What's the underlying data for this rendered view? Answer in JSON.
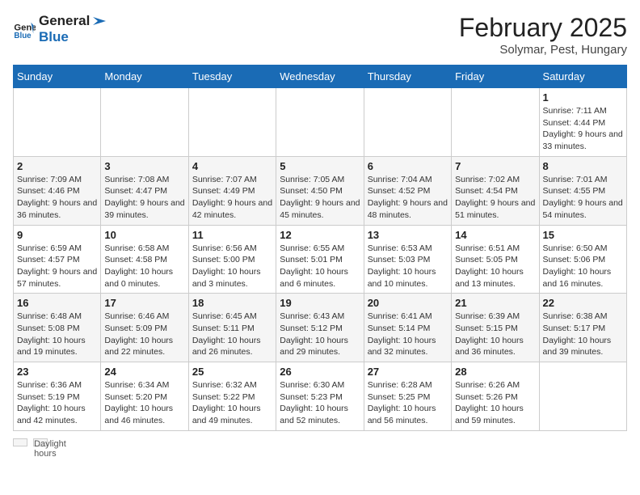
{
  "header": {
    "logo_line1": "General",
    "logo_line2": "Blue",
    "title": "February 2025",
    "subtitle": "Solymar, Pest, Hungary"
  },
  "days_of_week": [
    "Sunday",
    "Monday",
    "Tuesday",
    "Wednesday",
    "Thursday",
    "Friday",
    "Saturday"
  ],
  "weeks": [
    [
      {
        "day": "",
        "info": ""
      },
      {
        "day": "",
        "info": ""
      },
      {
        "day": "",
        "info": ""
      },
      {
        "day": "",
        "info": ""
      },
      {
        "day": "",
        "info": ""
      },
      {
        "day": "",
        "info": ""
      },
      {
        "day": "1",
        "info": "Sunrise: 7:11 AM\nSunset: 4:44 PM\nDaylight: 9 hours and 33 minutes."
      }
    ],
    [
      {
        "day": "2",
        "info": "Sunrise: 7:09 AM\nSunset: 4:46 PM\nDaylight: 9 hours and 36 minutes."
      },
      {
        "day": "3",
        "info": "Sunrise: 7:08 AM\nSunset: 4:47 PM\nDaylight: 9 hours and 39 minutes."
      },
      {
        "day": "4",
        "info": "Sunrise: 7:07 AM\nSunset: 4:49 PM\nDaylight: 9 hours and 42 minutes."
      },
      {
        "day": "5",
        "info": "Sunrise: 7:05 AM\nSunset: 4:50 PM\nDaylight: 9 hours and 45 minutes."
      },
      {
        "day": "6",
        "info": "Sunrise: 7:04 AM\nSunset: 4:52 PM\nDaylight: 9 hours and 48 minutes."
      },
      {
        "day": "7",
        "info": "Sunrise: 7:02 AM\nSunset: 4:54 PM\nDaylight: 9 hours and 51 minutes."
      },
      {
        "day": "8",
        "info": "Sunrise: 7:01 AM\nSunset: 4:55 PM\nDaylight: 9 hours and 54 minutes."
      }
    ],
    [
      {
        "day": "9",
        "info": "Sunrise: 6:59 AM\nSunset: 4:57 PM\nDaylight: 9 hours and 57 minutes."
      },
      {
        "day": "10",
        "info": "Sunrise: 6:58 AM\nSunset: 4:58 PM\nDaylight: 10 hours and 0 minutes."
      },
      {
        "day": "11",
        "info": "Sunrise: 6:56 AM\nSunset: 5:00 PM\nDaylight: 10 hours and 3 minutes."
      },
      {
        "day": "12",
        "info": "Sunrise: 6:55 AM\nSunset: 5:01 PM\nDaylight: 10 hours and 6 minutes."
      },
      {
        "day": "13",
        "info": "Sunrise: 6:53 AM\nSunset: 5:03 PM\nDaylight: 10 hours and 10 minutes."
      },
      {
        "day": "14",
        "info": "Sunrise: 6:51 AM\nSunset: 5:05 PM\nDaylight: 10 hours and 13 minutes."
      },
      {
        "day": "15",
        "info": "Sunrise: 6:50 AM\nSunset: 5:06 PM\nDaylight: 10 hours and 16 minutes."
      }
    ],
    [
      {
        "day": "16",
        "info": "Sunrise: 6:48 AM\nSunset: 5:08 PM\nDaylight: 10 hours and 19 minutes."
      },
      {
        "day": "17",
        "info": "Sunrise: 6:46 AM\nSunset: 5:09 PM\nDaylight: 10 hours and 22 minutes."
      },
      {
        "day": "18",
        "info": "Sunrise: 6:45 AM\nSunset: 5:11 PM\nDaylight: 10 hours and 26 minutes."
      },
      {
        "day": "19",
        "info": "Sunrise: 6:43 AM\nSunset: 5:12 PM\nDaylight: 10 hours and 29 minutes."
      },
      {
        "day": "20",
        "info": "Sunrise: 6:41 AM\nSunset: 5:14 PM\nDaylight: 10 hours and 32 minutes."
      },
      {
        "day": "21",
        "info": "Sunrise: 6:39 AM\nSunset: 5:15 PM\nDaylight: 10 hours and 36 minutes."
      },
      {
        "day": "22",
        "info": "Sunrise: 6:38 AM\nSunset: 5:17 PM\nDaylight: 10 hours and 39 minutes."
      }
    ],
    [
      {
        "day": "23",
        "info": "Sunrise: 6:36 AM\nSunset: 5:19 PM\nDaylight: 10 hours and 42 minutes."
      },
      {
        "day": "24",
        "info": "Sunrise: 6:34 AM\nSunset: 5:20 PM\nDaylight: 10 hours and 46 minutes."
      },
      {
        "day": "25",
        "info": "Sunrise: 6:32 AM\nSunset: 5:22 PM\nDaylight: 10 hours and 49 minutes."
      },
      {
        "day": "26",
        "info": "Sunrise: 6:30 AM\nSunset: 5:23 PM\nDaylight: 10 hours and 52 minutes."
      },
      {
        "day": "27",
        "info": "Sunrise: 6:28 AM\nSunset: 5:25 PM\nDaylight: 10 hours and 56 minutes."
      },
      {
        "day": "28",
        "info": "Sunrise: 6:26 AM\nSunset: 5:26 PM\nDaylight: 10 hours and 59 minutes."
      },
      {
        "day": "",
        "info": ""
      }
    ]
  ],
  "footer": {
    "daylight_label": "Daylight hours"
  }
}
